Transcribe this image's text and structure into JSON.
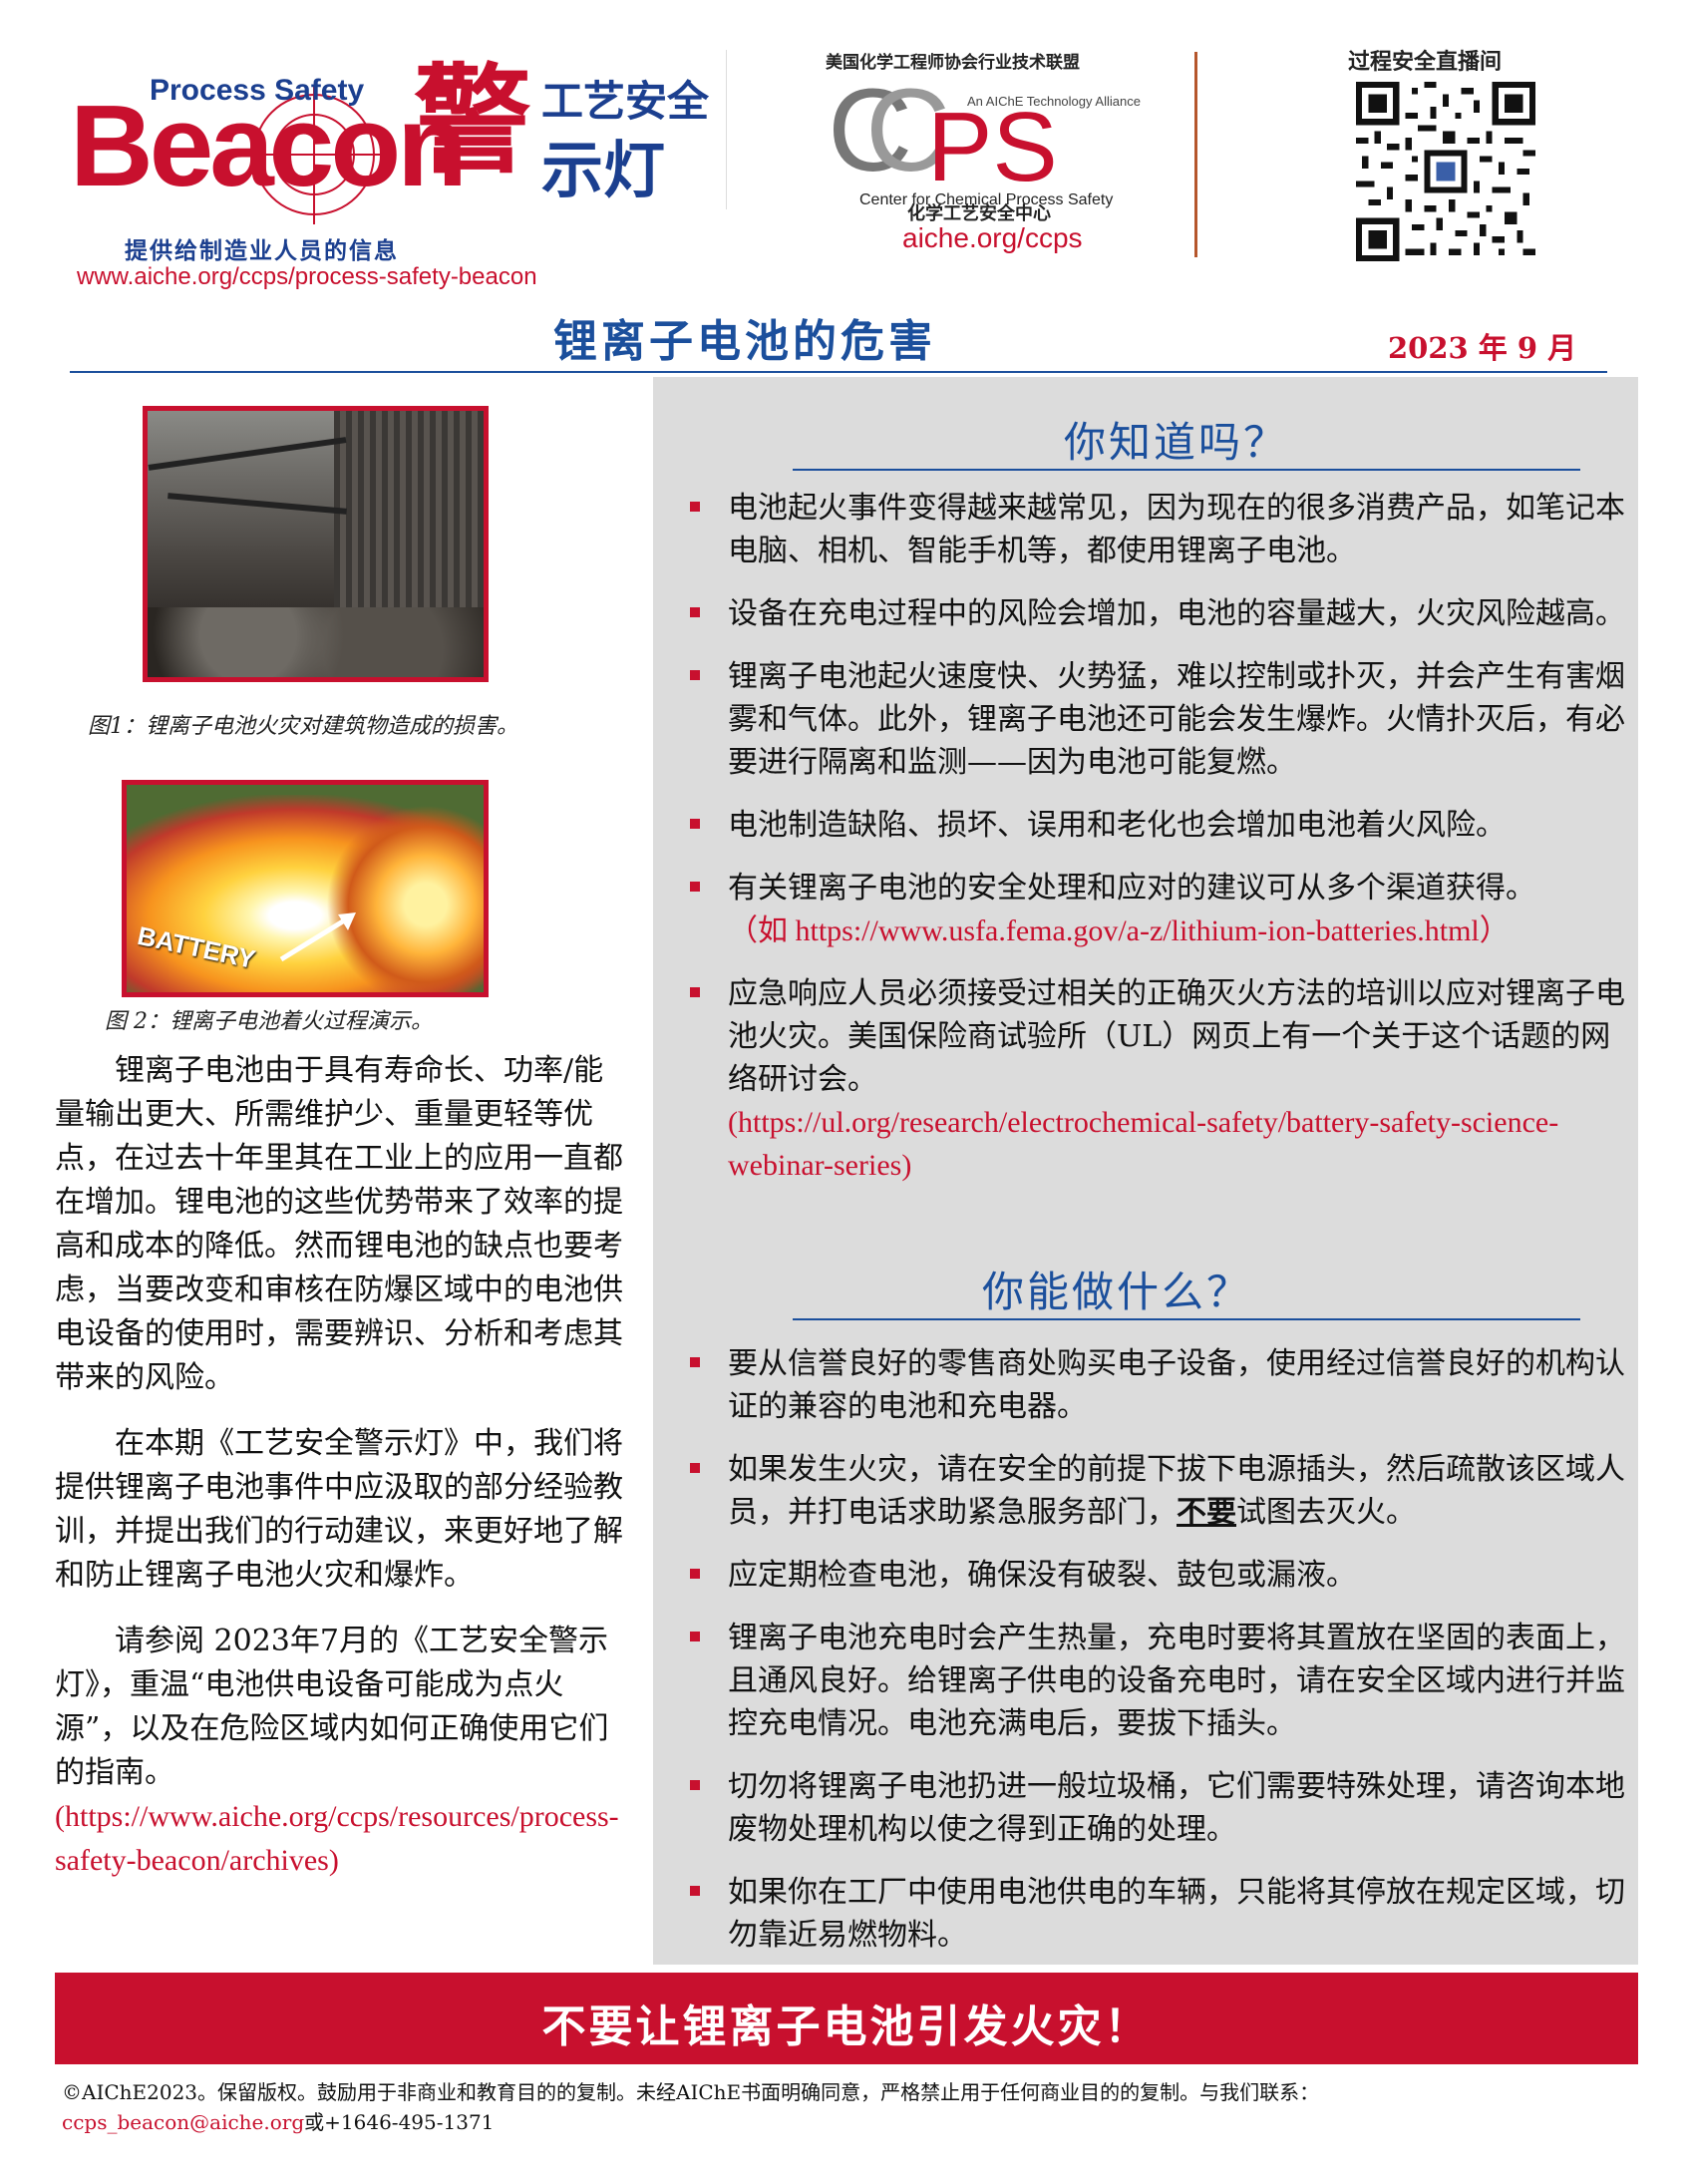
{
  "header": {
    "beacon_logo_ps": "Process Safety",
    "beacon_logo_word": "Beacon",
    "cn_logo_big": "警",
    "cn_logo_top": "工艺安全",
    "cn_logo_bottom": "示灯",
    "tagline": "提供给制造业人员的信息",
    "beacon_url": "www.aiche.org/ccps/process-safety-beacon",
    "ccps_alliance_cn": "美国化学工程师协会行业技术联盟",
    "ccps_alliance_en": "An AIChE Technology Alliance",
    "ccps_logo_c": "C",
    "ccps_logo_ps": "PS",
    "ccps_center_en": "Center for Chemical Process Safety",
    "ccps_center_cn": "化学工艺安全中心",
    "ccps_url": "aiche.org/ccps",
    "live_label": "过程安全直播间",
    "title": "锂离子电池的危害",
    "date": "2023 年 9 月"
  },
  "figures": {
    "fig1_caption": "图1：锂离子电池火灾对建筑物造成的损害。",
    "fig2_label": "BATTERY",
    "fig2_caption": "图 2：锂离子电池着火过程演示。"
  },
  "left": {
    "p1": "锂离子电池由于具有寿命长、功率/能量输出更大、所需维护少、重量更轻等优点，在过去十年里其在工业上的应用一直都在增加。锂电池的这些优势带来了效率的提高和成本的降低。然而锂电池的缺点也要考虑，当要改变和审核在防爆区域中的电池供电设备的使用时，需要辨识、分析和考虑其带来的风险。",
    "p2": "在本期《工艺安全警示灯》中，我们将提供锂离子电池事件中应汲取的部分经验教训，并提出我们的行动建议，来更好地了解和防止锂离子电池火灾和爆炸。",
    "p3": "请参阅 2023年7月的《工艺安全警示灯》，重温“电池供电设备可能成为点火源”，以及在危险区域内如何正确使用它们的指南。",
    "p3_url": "(https://www.aiche.org/ccps/resources/process-safety-beacon/archives)"
  },
  "know": {
    "heading": "你知道吗？",
    "items": [
      "电池起火事件变得越来越常见，因为现在的很多消费产品，如笔记本电脑、相机、智能手机等，都使用锂离子电池。",
      "设备在充电过程中的风险会增加，电池的容量越大，火灾风险越高。",
      "锂离子电池起火速度快、火势猛，难以控制或扑灭，并会产生有害烟雾和气体。此外，锂离子电池还可能会发生爆炸。火情扑灭后，有必要进行隔离和监测——因为电池可能复燃。",
      "电池制造缺陷、损坏、误用和老化也会增加电池着火风险。",
      "有关锂离子电池的安全处理和应对的建议可从多个渠道获得。"
    ],
    "item5_url": "（如 https://www.usfa.fema.gov/a-z/lithium-ion-batteries.html）",
    "item6": "应急响应人员必须接受过相关的正确灭火方法的培训以应对锂离子电池火灾。美国保险商试验所（UL）网页上有一个关于这个话题的网络研讨会。",
    "item6_url": "(https://ul.org/research/electrochemical-safety/battery-safety-science-webinar-series)"
  },
  "do": {
    "heading": "你能做什么？",
    "item1": "要从信誉良好的零售商处购买电子设备，使用经过信誉良好的机构认证的兼容的电池和充电器。",
    "item2_a": "如果发生火灾，请在安全的前提下拔下电源插头，然后疏散该区域人员，并打电话求助紧急服务部门，",
    "item2_u": "不要",
    "item2_b": "试图去灭火。",
    "item3": "应定期检查电池，确保没有破裂、鼓包或漏液。",
    "item4": "锂离子电池充电时会产生热量，充电时要将其置放在坚固的表面上，且通风良好。给锂离子供电的设备充电时，请在安全区域内进行并监控充电情况。电池充满电后，要拔下插头。",
    "item5": "切勿将锂离子电池扔进一般垃圾桶，它们需要特殊处理，请咨询本地废物处理机构以使之得到正确的处理。",
    "item6": "如果你在工厂中使用电池供电的车辆，只能将其停放在规定区域，切勿靠近易燃物料。"
  },
  "footer": {
    "banner": "不要让锂离子电池引发火灾！",
    "copyright": "©AIChE2023。保留版权。鼓励用于非商业和教育目的的复制。未经AIChE书面明确同意，严格禁止用于任何商业目的的复制。与我们联系：",
    "email": "ccps_beacon@aiche.org",
    "phone": "或+1646-495-1371"
  },
  "colors": {
    "brand_red": "#c8102e",
    "brand_blue": "#1b4f9c",
    "panel_gray": "#dcdcdc"
  }
}
